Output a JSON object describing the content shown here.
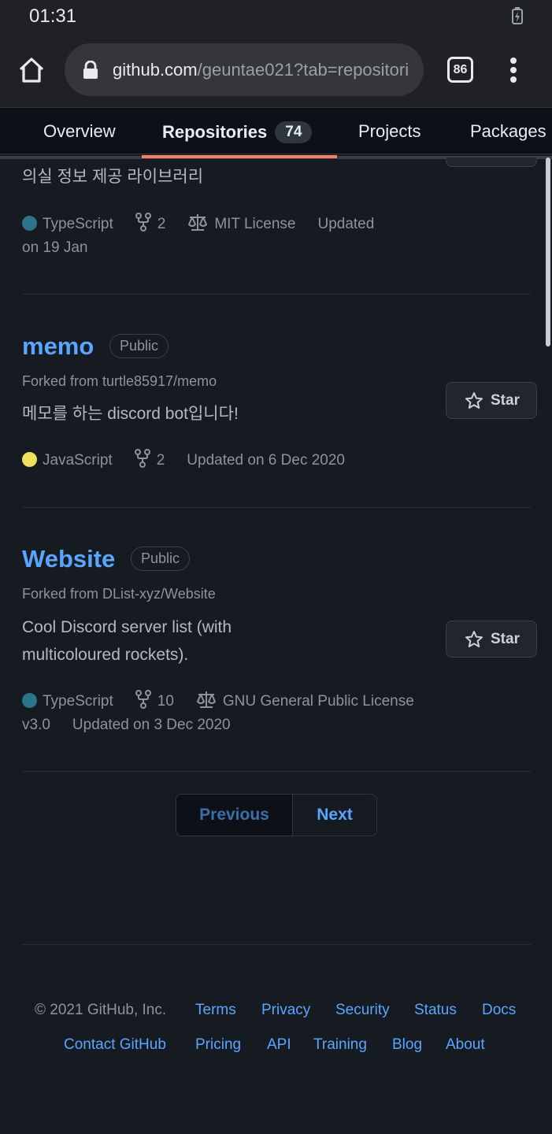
{
  "status_bar": {
    "time": "01:31"
  },
  "browser": {
    "url_host": "github.com",
    "url_path": "/geuntae021?tab=repositori",
    "tab_count": "86"
  },
  "nav": {
    "overview": "Overview",
    "repositories": "Repositories",
    "repositories_count": "74",
    "projects": "Projects",
    "packages": "Packages"
  },
  "repo_partial": {
    "description": "의실 정보 제공 라이브러리",
    "language": "TypeScript",
    "language_color": "#2b7489",
    "forks": "2",
    "license": "MIT License",
    "updated_prefix": "Updated",
    "updated_date": "on 19 Jan"
  },
  "repos": [
    {
      "name": "memo",
      "visibility": "Public",
      "forked_from": "Forked from turtle85917/memo",
      "description": "메모를 하는 discord bot입니다!",
      "language": "JavaScript",
      "language_color": "#f1e05a",
      "forks": "2",
      "updated": "Updated on 6 Dec 2020",
      "star_label": "Star"
    },
    {
      "name": "Website",
      "visibility": "Public",
      "forked_from": "Forked from DList-xyz/Website",
      "description_line1": "Cool Discord server list (with",
      "description_line2": "multicoloured rockets).",
      "language": "TypeScript",
      "language_color": "#2b7489",
      "forks": "10",
      "license": "GNU General Public License",
      "license_version": "v3.0",
      "updated": "Updated on 3 Dec 2020",
      "star_label": "Star"
    }
  ],
  "pagination": {
    "previous": "Previous",
    "next": "Next"
  },
  "footer": {
    "copyright": "© 2021 GitHub, Inc.",
    "links_row1": [
      "Terms",
      "Privacy",
      "Security",
      "Status",
      "Docs"
    ],
    "links_row2": [
      "Contact GitHub",
      "Pricing",
      "API",
      "Training",
      "Blog",
      "About"
    ]
  }
}
